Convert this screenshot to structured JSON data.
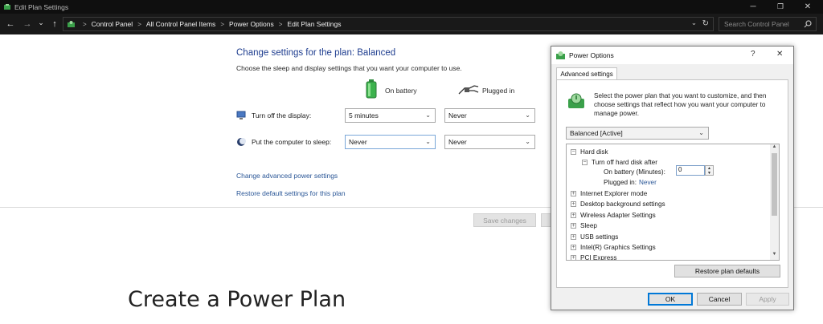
{
  "window": {
    "title": "Edit Plan Settings",
    "minimize": "─",
    "maximize": "❐",
    "close": "✕"
  },
  "nav": {
    "back": "←",
    "forward": "→",
    "recent": "⌄",
    "up": "↑"
  },
  "address": {
    "crumbs": [
      "Control Panel",
      "All Control Panel Items",
      "Power Options",
      "Edit Plan Settings"
    ],
    "separator": ">",
    "dropdown": "⌄",
    "refresh": "↻"
  },
  "search": {
    "placeholder": "Search Control Panel"
  },
  "plan": {
    "title": "Change settings for the plan: Balanced",
    "description": "Choose the sleep and display settings that you want your computer to use.",
    "col_battery": "On battery",
    "col_plugged": "Plugged in",
    "rows": [
      {
        "label": "Turn off the display:",
        "battery": "5 minutes",
        "plugged": "Never"
      },
      {
        "label": "Put the computer to sleep:",
        "battery": "Never",
        "plugged": "Never"
      }
    ],
    "link_advanced": "Change advanced power settings",
    "link_restore": "Restore default settings for this plan",
    "save_label": "Save changes"
  },
  "overlay_heading": "Create a Power Plan",
  "dialog": {
    "title": "Power Options",
    "help": "?",
    "close": "✕",
    "tab": "Advanced settings",
    "description": "Select the power plan that you want to customize, and then choose settings that reflect how you want your computer to manage power.",
    "plan_select": "Balanced [Active]",
    "tree": {
      "hard_disk": "Hard disk",
      "turn_off": "Turn off hard disk after",
      "on_battery_label": "On battery (Minutes):",
      "on_battery_value": "0",
      "plugged_label": "Plugged in:",
      "plugged_value": "Never",
      "items": [
        "Internet Explorer mode",
        "Desktop background settings",
        "Wireless Adapter Settings",
        "Sleep",
        "USB settings",
        "Intel(R) Graphics Settings",
        "PCI Express"
      ],
      "expanded_glyph": "−",
      "collapsed_glyph": "+"
    },
    "restore_label": "Restore plan defaults",
    "ok_label": "OK",
    "cancel_label": "Cancel",
    "apply_label": "Apply"
  },
  "colors": {
    "link": "#2b5797",
    "title_blue": "#1e3d8f",
    "dark_chrome": "#191919",
    "accent": "#0078d7"
  }
}
